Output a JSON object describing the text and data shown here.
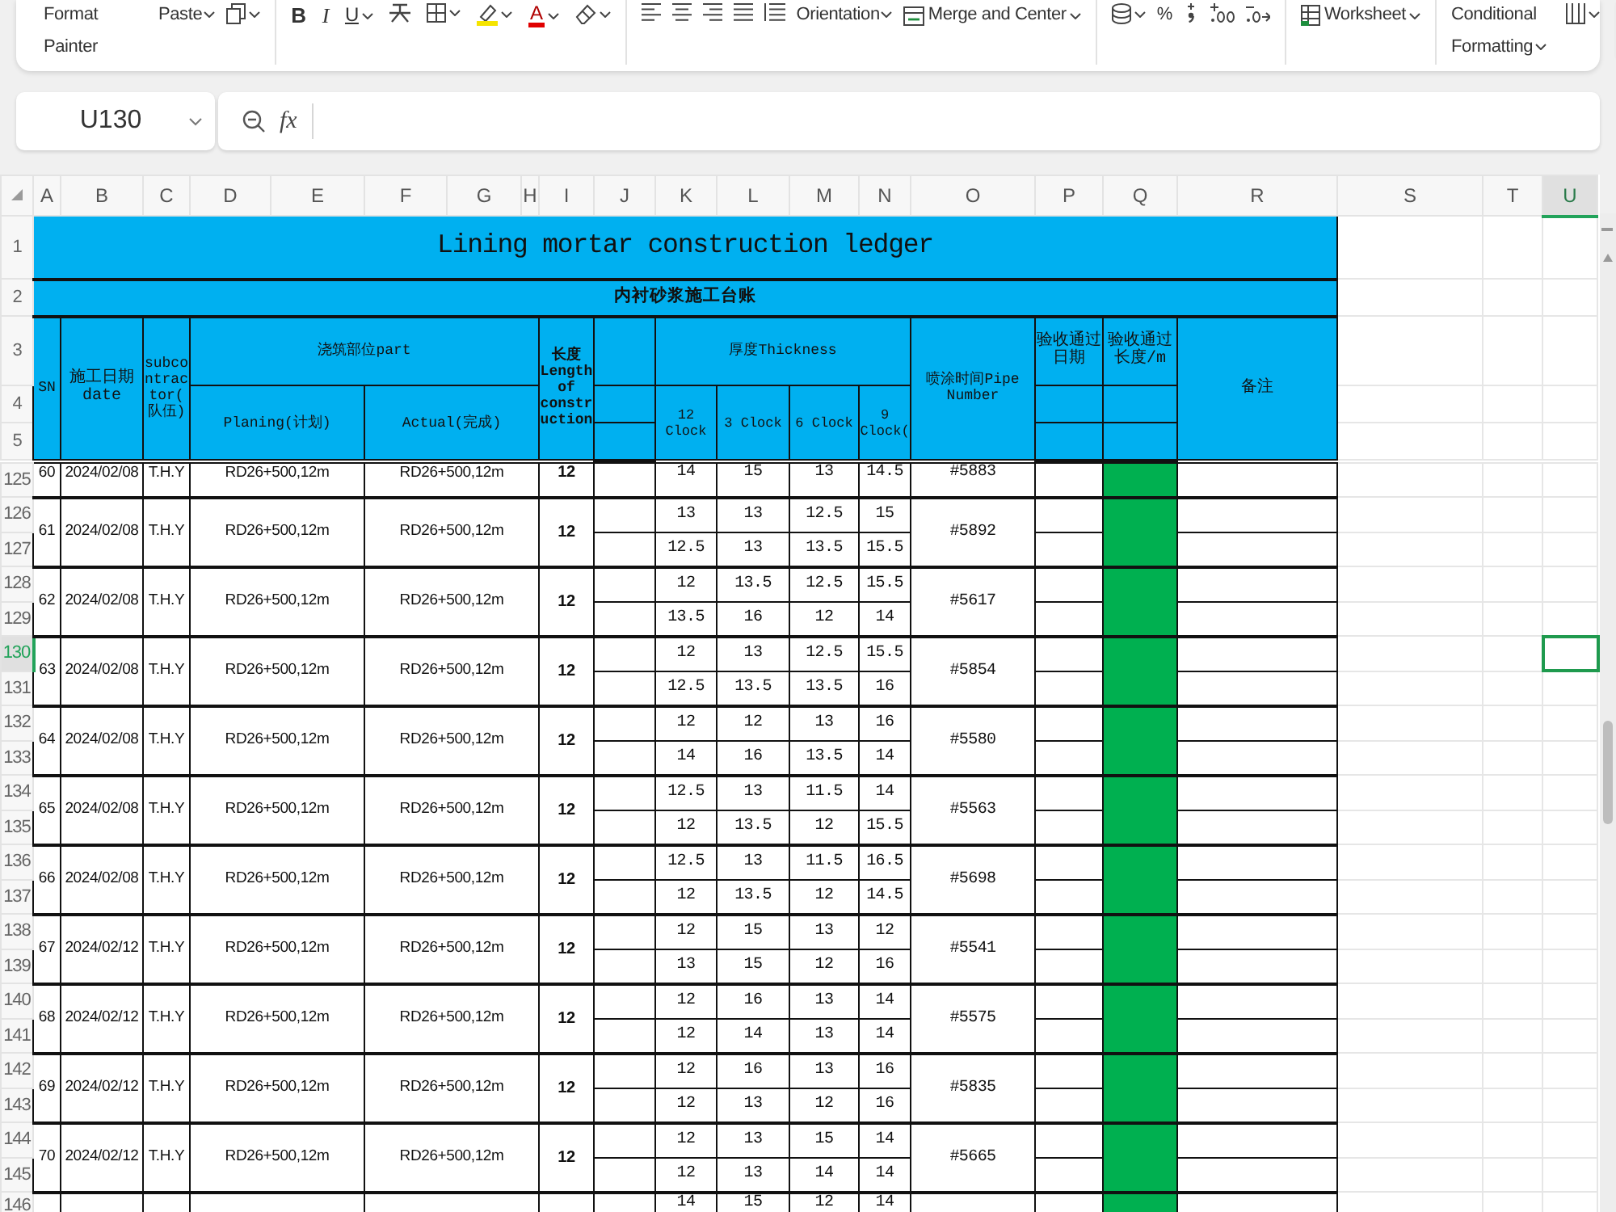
{
  "toolbar": {
    "groups": [
      [
        {
          "kind": "text",
          "label": "Format Painter",
          "dropdown": false
        },
        {
          "kind": "text",
          "label": "Paste",
          "dropdown": true
        },
        {
          "kind": "copy",
          "dropdown": true
        }
      ],
      [
        {
          "kind": "bold",
          "label": "B",
          "dropdown": false
        },
        {
          "kind": "italic",
          "label": "I",
          "dropdown": false
        },
        {
          "kind": "underline",
          "label": "U",
          "dropdown": true
        },
        {
          "kind": "strike",
          "dropdown": false
        },
        {
          "kind": "borders",
          "dropdown": true
        },
        {
          "kind": "highlight",
          "dropdown": true
        },
        {
          "kind": "fontcolor",
          "label": "A",
          "dropdown": true
        },
        {
          "kind": "clear",
          "dropdown": true
        }
      ],
      [
        {
          "kind": "alignleft",
          "dropdown": false
        },
        {
          "kind": "aligncenter",
          "dropdown": false
        },
        {
          "kind": "alignright",
          "dropdown": false
        },
        {
          "kind": "justify",
          "dropdown": false
        },
        {
          "kind": "distributed",
          "dropdown": false
        },
        {
          "kind": "text",
          "label": "Orientation",
          "dropdown": true
        },
        {
          "kind": "merge",
          "label": "Merge and Center",
          "dropdown": true
        }
      ],
      [
        {
          "kind": "coins",
          "dropdown": true
        },
        {
          "kind": "text",
          "label": "%",
          "dropdown": false
        },
        {
          "kind": "comma",
          "dropdown": false
        },
        {
          "kind": "adddecimal",
          "dropdown": false
        },
        {
          "kind": "removedecimal",
          "dropdown": false
        }
      ],
      [
        {
          "kind": "sheet",
          "label": "Worksheet",
          "dropdown": true
        }
      ],
      [
        {
          "kind": "text",
          "label": "Conditional Formatting",
          "dropdown": true
        },
        {
          "kind": "table",
          "dropdown": true
        }
      ]
    ]
  },
  "name_box": {
    "value": "U130"
  },
  "formula_bar": {
    "function_label": "fx"
  },
  "columns": [
    {
      "label": "A",
      "selected": false
    },
    {
      "label": "B",
      "selected": false
    },
    {
      "label": "C",
      "selected": false
    },
    {
      "label": "D",
      "selected": false
    },
    {
      "label": "E",
      "selected": false
    },
    {
      "label": "F",
      "selected": false
    },
    {
      "label": "G",
      "selected": false
    },
    {
      "label": "H",
      "selected": false
    },
    {
      "label": "I",
      "selected": false
    },
    {
      "label": "J",
      "selected": false
    },
    {
      "label": "K",
      "selected": false
    },
    {
      "label": "L",
      "selected": false
    },
    {
      "label": "M",
      "selected": false
    },
    {
      "label": "N",
      "selected": false
    },
    {
      "label": "O",
      "selected": false
    },
    {
      "label": "P",
      "selected": false
    },
    {
      "label": "Q",
      "selected": false
    },
    {
      "label": "R",
      "selected": false
    },
    {
      "label": "S",
      "selected": false
    },
    {
      "label": "T",
      "selected": false
    },
    {
      "label": "U",
      "selected": true
    }
  ],
  "row_numbers": [
    {
      "label": "1",
      "selected": false
    },
    {
      "label": "2",
      "selected": false
    },
    {
      "label": "3",
      "selected": false
    },
    {
      "label": "4",
      "selected": false
    },
    {
      "label": "5",
      "selected": false
    },
    {
      "label": "125",
      "selected": false
    },
    {
      "label": "126",
      "selected": false
    },
    {
      "label": "127",
      "selected": false
    },
    {
      "label": "128",
      "selected": false
    },
    {
      "label": "129",
      "selected": false
    },
    {
      "label": "130",
      "selected": true
    },
    {
      "label": "131",
      "selected": false
    },
    {
      "label": "132",
      "selected": false
    },
    {
      "label": "133",
      "selected": false
    },
    {
      "label": "134",
      "selected": false
    },
    {
      "label": "135",
      "selected": false
    },
    {
      "label": "136",
      "selected": false
    },
    {
      "label": "137",
      "selected": false
    },
    {
      "label": "138",
      "selected": false
    },
    {
      "label": "139",
      "selected": false
    },
    {
      "label": "140",
      "selected": false
    },
    {
      "label": "141",
      "selected": false
    },
    {
      "label": "142",
      "selected": false
    },
    {
      "label": "143",
      "selected": false
    },
    {
      "label": "144",
      "selected": false
    },
    {
      "label": "145",
      "selected": false
    },
    {
      "label": "146",
      "selected": false
    }
  ],
  "ledger": {
    "title": "Lining mortar construction ledger",
    "subtitle": "内衬砂浆施工台账",
    "headers": {
      "sn": "SN",
      "date": "施工日期 date",
      "subcontractor": "subcontractor(队伍)",
      "part": "浇筑部位part",
      "planning": "Planing(计划)",
      "actual": "Actual(完成)",
      "length": "长度Length of construction",
      "thickness": "厚度Thickness",
      "clocks": [
        "12 Clock",
        "3 Clock",
        "6 Clock",
        "9 Clock("
      ],
      "pipe": "喷涂时间Pipe Number",
      "accept_date": "验收通过日期",
      "accept_length": "验收通过长度/m",
      "remarks": "备注"
    },
    "records": [
      {
        "kind": "continued",
        "sn": "60",
        "date": "2024/02/08",
        "subcontractor": "T.H.Y",
        "planning": "RD26+500,12m",
        "actual": "RD26+500,12m",
        "length": "12",
        "thickness": [
          [
            "14",
            "15",
            "13",
            "14.5"
          ]
        ],
        "pipe": "#5883"
      },
      {
        "kind": "full",
        "sn": "61",
        "date": "2024/02/08",
        "subcontractor": "T.H.Y",
        "planning": "RD26+500,12m",
        "actual": "RD26+500,12m",
        "length": "12",
        "thickness": [
          [
            "13",
            "13",
            "12.5",
            "15"
          ],
          [
            "12.5",
            "13",
            "13.5",
            "15.5"
          ]
        ],
        "pipe": "#5892"
      },
      {
        "kind": "full",
        "sn": "62",
        "date": "2024/02/08",
        "subcontractor": "T.H.Y",
        "planning": "RD26+500,12m",
        "actual": "RD26+500,12m",
        "length": "12",
        "thickness": [
          [
            "12",
            "13.5",
            "12.5",
            "15.5"
          ],
          [
            "13.5",
            "16",
            "12",
            "14"
          ]
        ],
        "pipe": "#5617"
      },
      {
        "kind": "full",
        "sn": "63",
        "date": "2024/02/08",
        "subcontractor": "T.H.Y",
        "planning": "RD26+500,12m",
        "actual": "RD26+500,12m",
        "length": "12",
        "thickness": [
          [
            "12",
            "13",
            "12.5",
            "15.5"
          ],
          [
            "12.5",
            "13.5",
            "13.5",
            "16"
          ]
        ],
        "pipe": "#5854"
      },
      {
        "kind": "full",
        "sn": "64",
        "date": "2024/02/08",
        "subcontractor": "T.H.Y",
        "planning": "RD26+500,12m",
        "actual": "RD26+500,12m",
        "length": "12",
        "thickness": [
          [
            "12",
            "12",
            "13",
            "16"
          ],
          [
            "14",
            "16",
            "13.5",
            "14"
          ]
        ],
        "pipe": "#5580"
      },
      {
        "kind": "full",
        "sn": "65",
        "date": "2024/02/08",
        "subcontractor": "T.H.Y",
        "planning": "RD26+500,12m",
        "actual": "RD26+500,12m",
        "length": "12",
        "thickness": [
          [
            "12.5",
            "13",
            "11.5",
            "14"
          ],
          [
            "12",
            "13.5",
            "12",
            "15.5"
          ]
        ],
        "pipe": "#5563"
      },
      {
        "kind": "full",
        "sn": "66",
        "date": "2024/02/08",
        "subcontractor": "T.H.Y",
        "planning": "RD26+500,12m",
        "actual": "RD26+500,12m",
        "length": "12",
        "thickness": [
          [
            "12.5",
            "13",
            "11.5",
            "16.5"
          ],
          [
            "12",
            "13.5",
            "12",
            "14.5"
          ]
        ],
        "pipe": "#5698"
      },
      {
        "kind": "full",
        "sn": "67",
        "date": "2024/02/12",
        "subcontractor": "T.H.Y",
        "planning": "RD26+500,12m",
        "actual": "RD26+500,12m",
        "length": "12",
        "thickness": [
          [
            "12",
            "15",
            "13",
            "12"
          ],
          [
            "13",
            "15",
            "12",
            "16"
          ]
        ],
        "pipe": "#5541"
      },
      {
        "kind": "full",
        "sn": "68",
        "date": "2024/02/12",
        "subcontractor": "T.H.Y",
        "planning": "RD26+500,12m",
        "actual": "RD26+500,12m",
        "length": "12",
        "thickness": [
          [
            "12",
            "16",
            "13",
            "14"
          ],
          [
            "12",
            "14",
            "13",
            "14"
          ]
        ],
        "pipe": "#5575"
      },
      {
        "kind": "full",
        "sn": "69",
        "date": "2024/02/12",
        "subcontractor": "T.H.Y",
        "planning": "RD26+500,12m",
        "actual": "RD26+500,12m",
        "length": "12",
        "thickness": [
          [
            "12",
            "16",
            "13",
            "16"
          ],
          [
            "12",
            "13",
            "12",
            "16"
          ]
        ],
        "pipe": "#5835"
      },
      {
        "kind": "full",
        "sn": "70",
        "date": "2024/02/12",
        "subcontractor": "T.H.Y",
        "planning": "RD26+500,12m",
        "actual": "RD26+500,12m",
        "length": "12",
        "thickness": [
          [
            "12",
            "13",
            "15",
            "14"
          ],
          [
            "12",
            "13",
            "14",
            "14"
          ]
        ],
        "pipe": "#5665"
      },
      {
        "kind": "partial",
        "thickness": [
          [
            "14",
            "15",
            "12",
            "14"
          ]
        ]
      }
    ]
  }
}
